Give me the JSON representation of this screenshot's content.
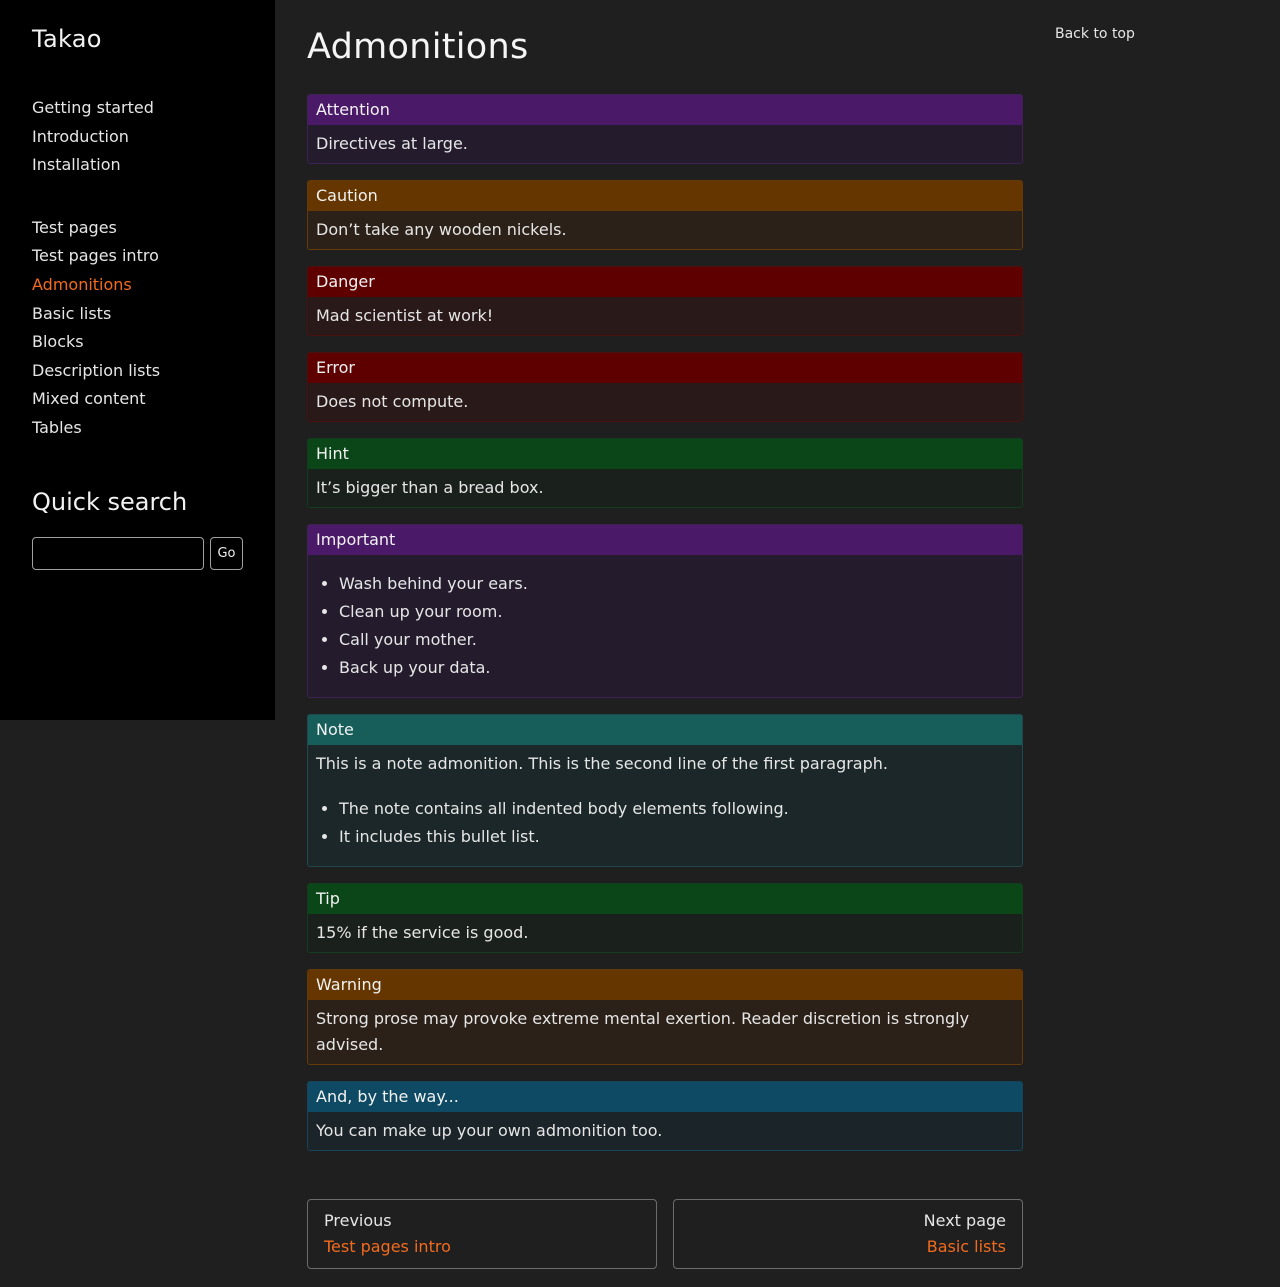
{
  "sidebar": {
    "brand": "Takao",
    "nav_group_1": [
      {
        "label": "Getting started"
      },
      {
        "label": "Introduction"
      },
      {
        "label": "Installation"
      }
    ],
    "nav_group_2": [
      {
        "label": "Test pages"
      },
      {
        "label": "Test pages intro"
      },
      {
        "label": "Admonitions",
        "active": true
      },
      {
        "label": "Basic lists"
      },
      {
        "label": "Blocks"
      },
      {
        "label": "Description lists"
      },
      {
        "label": "Mixed content"
      },
      {
        "label": "Tables"
      }
    ],
    "quick_search": {
      "title": "Quick search",
      "input_value": "",
      "button_label": "Go"
    }
  },
  "main": {
    "title": "Admonitions",
    "admonitions": [
      {
        "title": "Attention",
        "body": "Directives at large.",
        "title_color": "#4a1a69",
        "body_color": "#241c2d",
        "border_color": "#3e2253"
      },
      {
        "title": "Caution",
        "body": "Don’t take any wooden nickels.",
        "title_color": "#653600",
        "body_color": "#2b2118",
        "border_color": "#643a08"
      },
      {
        "title": "Danger",
        "body": "Mad scientist at work!",
        "title_color": "#5e0000",
        "body_color": "#2a1919",
        "border_color": "#4a1010"
      },
      {
        "title": "Error",
        "body": "Does not compute.",
        "title_color": "#5e0000",
        "body_color": "#2a1919",
        "border_color": "#4a1010"
      },
      {
        "title": "Hint",
        "body": "It’s bigger than a bread box.",
        "title_color": "#0b4619",
        "body_color": "#1a211c",
        "border_color": "#143d1e"
      },
      {
        "title": "Important",
        "list": [
          "Wash behind your ears.",
          "Clean up your room.",
          "Call your mother.",
          "Back up your data."
        ],
        "title_color": "#4a1a69",
        "body_color": "#241c2d",
        "border_color": "#3e2253"
      },
      {
        "title": "Note",
        "body": "This is a note admonition. This is the second line of the first paragraph.",
        "list": [
          "The note contains all indented body elements following.",
          "It includes this bullet list."
        ],
        "title_color": "#175e5a",
        "body_color": "#1b2728",
        "border_color": "#1e4a4f"
      },
      {
        "title": "Tip",
        "body": "15% if the service is good.",
        "title_color": "#0b4619",
        "body_color": "#1a211c",
        "border_color": "#143d1e"
      },
      {
        "title": "Warning",
        "body": "Strong prose may provoke extreme mental exertion. Reader discretion is strongly advised.",
        "title_color": "#653600",
        "body_color": "#2b2118",
        "border_color": "#643a08"
      },
      {
        "title": "And, by the way...",
        "body": "You can make up your own admonition too.",
        "title_color": "#0e4a63",
        "body_color": "#1b2428",
        "border_color": "#16445a"
      }
    ],
    "prev": {
      "label": "Previous",
      "target": "Test pages intro"
    },
    "next": {
      "label": "Next page",
      "target": "Basic lists"
    }
  },
  "toc": {
    "back_to_top": "Back to top"
  },
  "colors": {
    "accent": "#f26b1d",
    "sidebar_bg": "#000000",
    "page_bg": "#1f1f1f"
  }
}
